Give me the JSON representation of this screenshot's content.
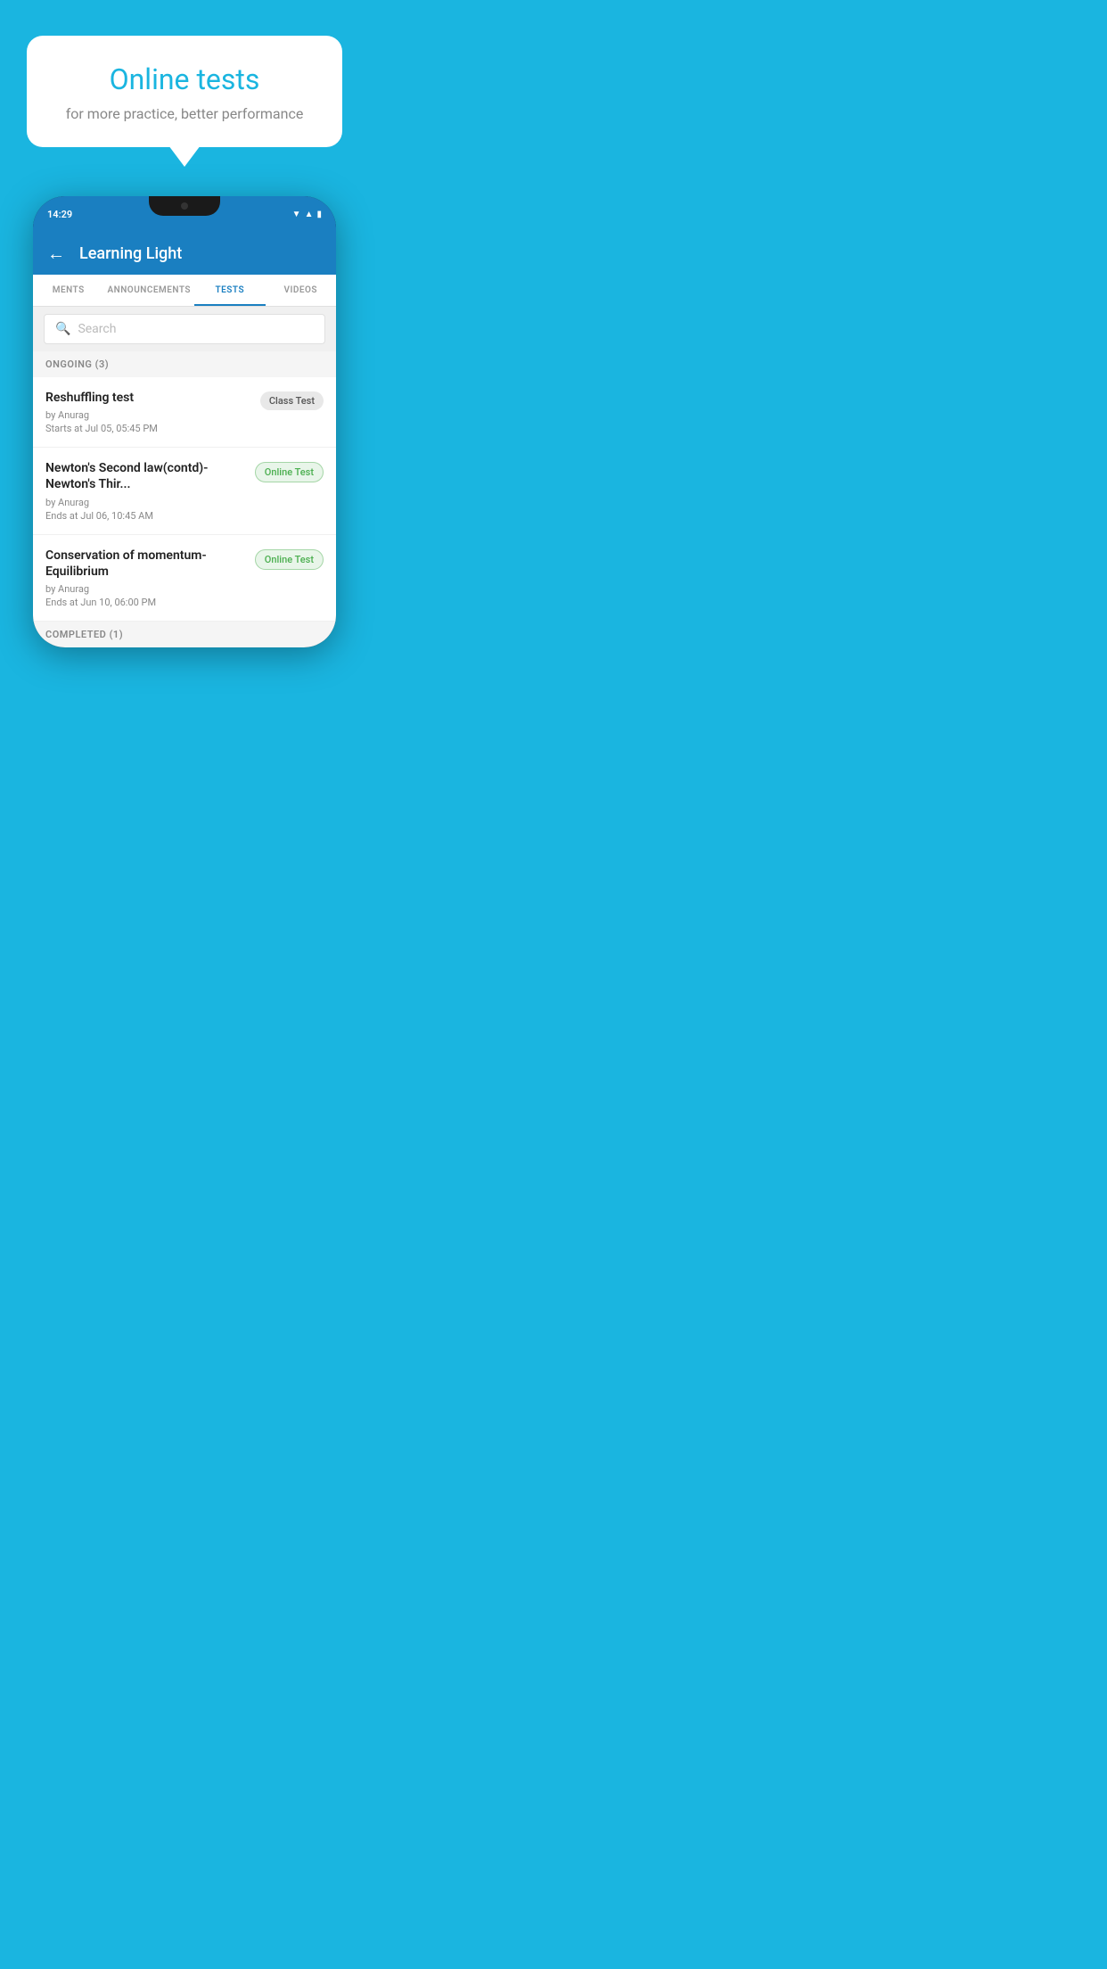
{
  "background_color": "#1ab5e0",
  "hero": {
    "title": "Online tests",
    "subtitle": "for more practice, better performance"
  },
  "phone": {
    "status_bar": {
      "time": "14:29"
    },
    "app_header": {
      "back_label": "←",
      "title": "Learning Light"
    },
    "tabs": [
      {
        "label": "MENTS",
        "active": false
      },
      {
        "label": "ANNOUNCEMENTS",
        "active": false
      },
      {
        "label": "TESTS",
        "active": true
      },
      {
        "label": "VIDEOS",
        "active": false
      }
    ],
    "search": {
      "placeholder": "Search"
    },
    "ongoing_section": {
      "label": "ONGOING (3)",
      "tests": [
        {
          "name": "Reshuffling test",
          "author": "by Anurag",
          "date": "Starts at  Jul 05, 05:45 PM",
          "badge": "Class Test",
          "badge_type": "class"
        },
        {
          "name": "Newton's Second law(contd)-Newton's Thir...",
          "author": "by Anurag",
          "date": "Ends at  Jul 06, 10:45 AM",
          "badge": "Online Test",
          "badge_type": "online"
        },
        {
          "name": "Conservation of momentum-Equilibrium",
          "author": "by Anurag",
          "date": "Ends at  Jun 10, 06:00 PM",
          "badge": "Online Test",
          "badge_type": "online"
        }
      ]
    },
    "completed_section": {
      "label": "COMPLETED (1)"
    }
  }
}
